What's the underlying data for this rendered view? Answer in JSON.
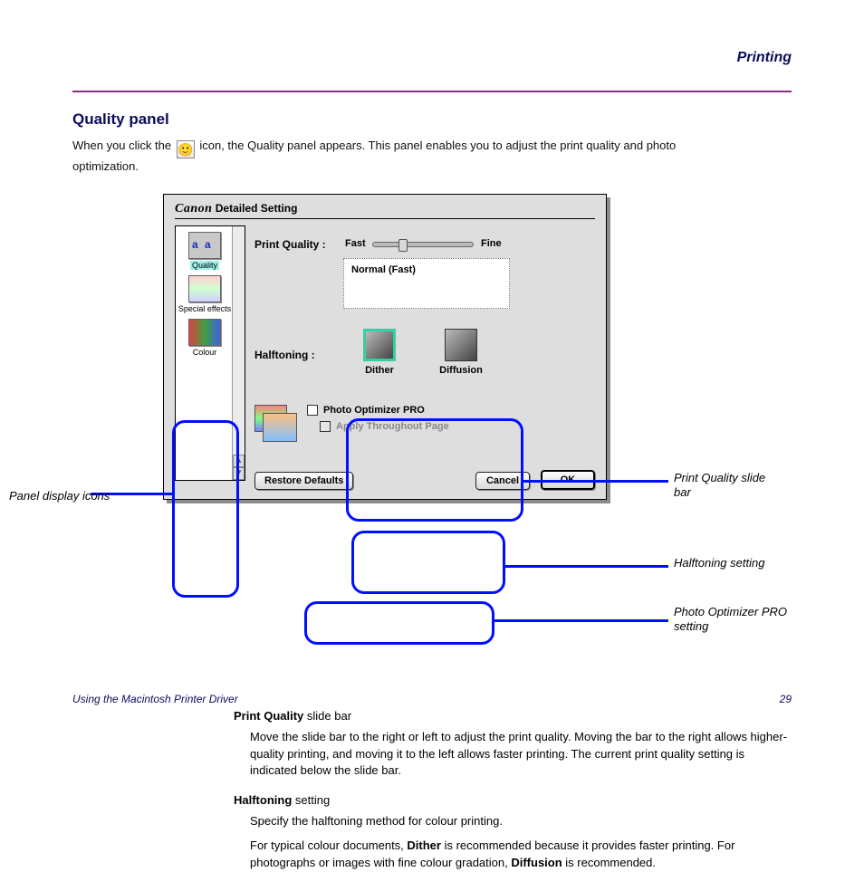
{
  "page": {
    "head_right": "Printing",
    "section_title": "Quality panel",
    "intro_pre": "When you click the ",
    "intro_post": " icon, the Quality panel appears. This panel enables you to adjust the print quality and photo optimization.",
    "footer_left": "Using the Macintosh Printer Driver",
    "footer_right": "29"
  },
  "dialog": {
    "brand": "Canon",
    "title": "Detailed Setting",
    "panels": {
      "quality": "Quality",
      "special": "Special effects",
      "colour": "Colour"
    },
    "labels": {
      "print_quality": "Print Quality :",
      "halftoning": "Halftoning :"
    },
    "slider": {
      "fast": "Fast",
      "fine": "Fine",
      "readout": "Normal (Fast)"
    },
    "halftone": {
      "dither": "Dither",
      "diffusion": "Diffusion"
    },
    "po": {
      "opt": "Photo Optimizer PRO",
      "apply": "Apply Throughout Page"
    },
    "buttons": {
      "restore": "Restore Defaults",
      "cancel": "Cancel",
      "ok": "OK"
    }
  },
  "callouts": {
    "panels": "Panel display icons",
    "quality": "Print Quality slide bar",
    "half": "Halftoning setting",
    "photo": "Photo Optimizer PRO setting"
  },
  "after": {
    "t1a": "Print Quality",
    "t1b": " slide bar",
    "p1": "Move the slide bar to the right or left to adjust the print quality. Moving the bar to the right allows higher-quality printing, and moving it to the left allows faster printing. The current print quality setting is indicated below the slide bar.",
    "t2a": "Halftoning",
    "t2b": " setting",
    "p2": "Specify the halftoning method for colour printing.",
    "p3a": "For typical colour documents, ",
    "p3b": "Dither",
    "p3c": " is recommended because it provides faster printing. For photographs or images with fine colour gradation, ",
    "p3d": "Diffusion",
    "p3e": " is recommended."
  }
}
